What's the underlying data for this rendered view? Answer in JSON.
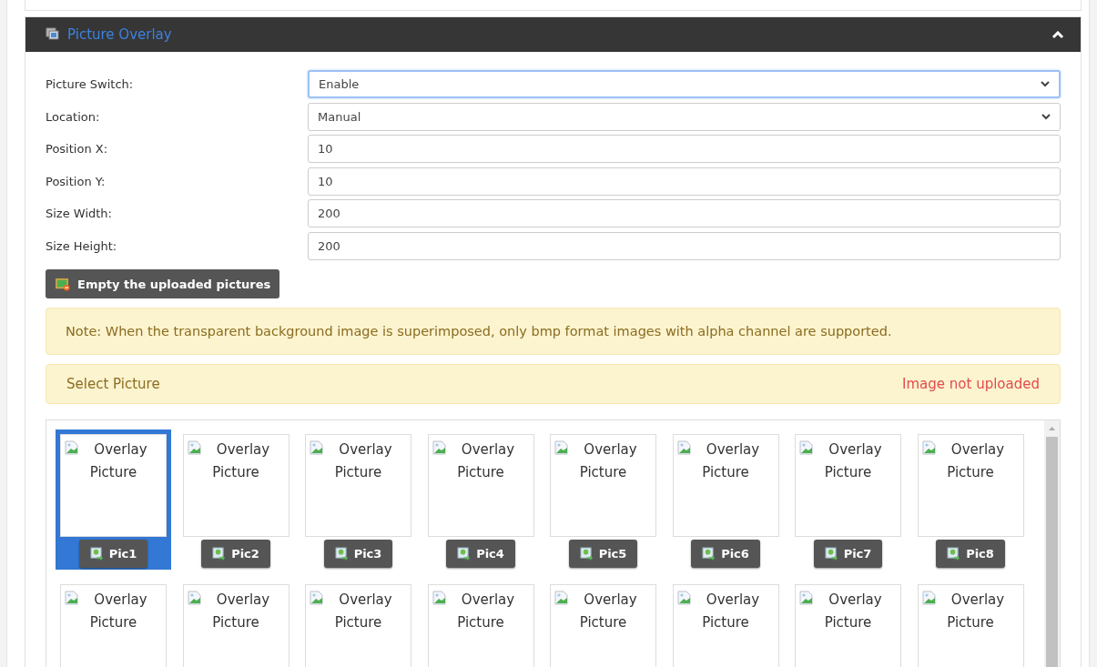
{
  "panel": {
    "title": "Picture Overlay",
    "expanded": true
  },
  "fields": [
    {
      "label": "Picture Switch:",
      "kind": "select",
      "value": "Enable",
      "focused": true
    },
    {
      "label": "Location:",
      "kind": "select",
      "value": "Manual",
      "focused": false
    },
    {
      "label": "Position X:",
      "kind": "input",
      "value": "10",
      "focused": false
    },
    {
      "label": "Position Y:",
      "kind": "input",
      "value": "10",
      "focused": false
    },
    {
      "label": "Size Width:",
      "kind": "input",
      "value": "200",
      "focused": false
    },
    {
      "label": "Size Height:",
      "kind": "input",
      "value": "200",
      "focused": false
    }
  ],
  "empty_button": "Empty the uploaded pictures",
  "note": "Note: When the transparent background image is superimposed, only bmp format images with alpha channel are supported.",
  "select_bar": {
    "title": "Select Picture",
    "status": "Image not uploaded"
  },
  "tiles": [
    {
      "alt": "Overlay Picture",
      "label": "Pic1",
      "selected": true
    },
    {
      "alt": "Overlay Picture",
      "label": "Pic2",
      "selected": false
    },
    {
      "alt": "Overlay Picture",
      "label": "Pic3",
      "selected": false
    },
    {
      "alt": "Overlay Picture",
      "label": "Pic4",
      "selected": false
    },
    {
      "alt": "Overlay Picture",
      "label": "Pic5",
      "selected": false
    },
    {
      "alt": "Overlay Picture",
      "label": "Pic6",
      "selected": false
    },
    {
      "alt": "Overlay Picture",
      "label": "Pic7",
      "selected": false
    },
    {
      "alt": "Overlay Picture",
      "label": "Pic8",
      "selected": false
    },
    {
      "alt": "Overlay Picture",
      "selected": false
    },
    {
      "alt": "Overlay Picture",
      "selected": false
    },
    {
      "alt": "Overlay Picture",
      "selected": false
    },
    {
      "alt": "Overlay Picture",
      "selected": false
    },
    {
      "alt": "Overlay Picture",
      "selected": false
    },
    {
      "alt": "Overlay Picture",
      "selected": false
    },
    {
      "alt": "Overlay Picture",
      "selected": false
    },
    {
      "alt": "Overlay Picture",
      "selected": false
    }
  ]
}
